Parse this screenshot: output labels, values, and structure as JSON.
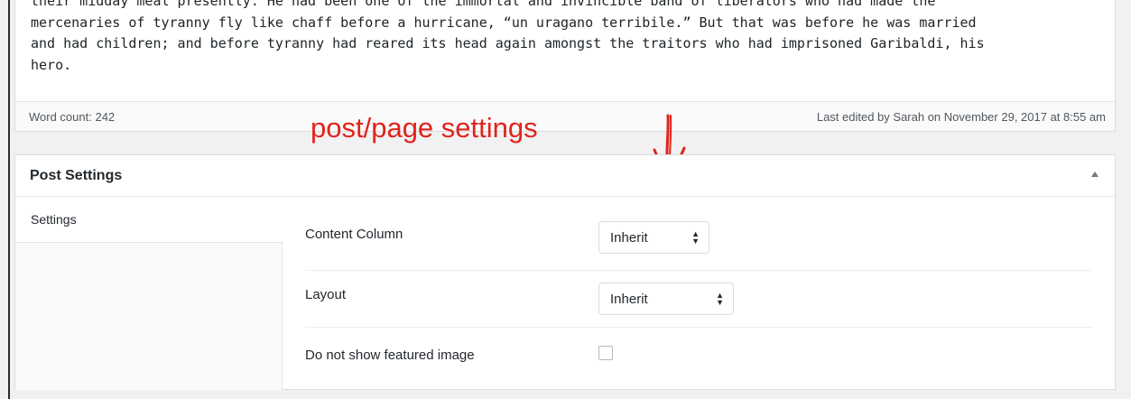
{
  "editor": {
    "paragraph": "their midday meal presently. He had been one of the immortal and invincible band of liberators who had made the mercenaries of tyranny fly like chaff before a hurricane, “un uragano terribile.” But that was before he was married and had children; and before tyranny had reared its head again amongst the traitors who had imprisoned Garibaldi, his hero.",
    "lines": [
      "their midday meal presently. He had been one of the immortal and invincible band of liberators who had made the",
      "mercenaries of tyranny fly like chaff before a hurricane, “un uragano terribile.” But that was before he was married",
      "and had children; and before tyranny had reared its head again amongst the traitors who had imprisoned Garibaldi, his",
      "hero."
    ],
    "word_count": "Word count: 242",
    "last_edited": "Last edited by Sarah on November 29, 2017 at 8:55 am"
  },
  "annotation": {
    "text": "post/page settings",
    "color": "#e0231c"
  },
  "post_settings": {
    "title": "Post Settings",
    "toggle_icon": "triangle-up-icon",
    "tabs": [
      {
        "label": "Settings",
        "active": true
      }
    ],
    "fields": {
      "content_column": {
        "label": "Content Column",
        "value": "Inherit"
      },
      "layout": {
        "label": "Layout",
        "value": "Inherit"
      },
      "featured_image": {
        "label": "Do not show featured image",
        "checked": false
      }
    }
  }
}
